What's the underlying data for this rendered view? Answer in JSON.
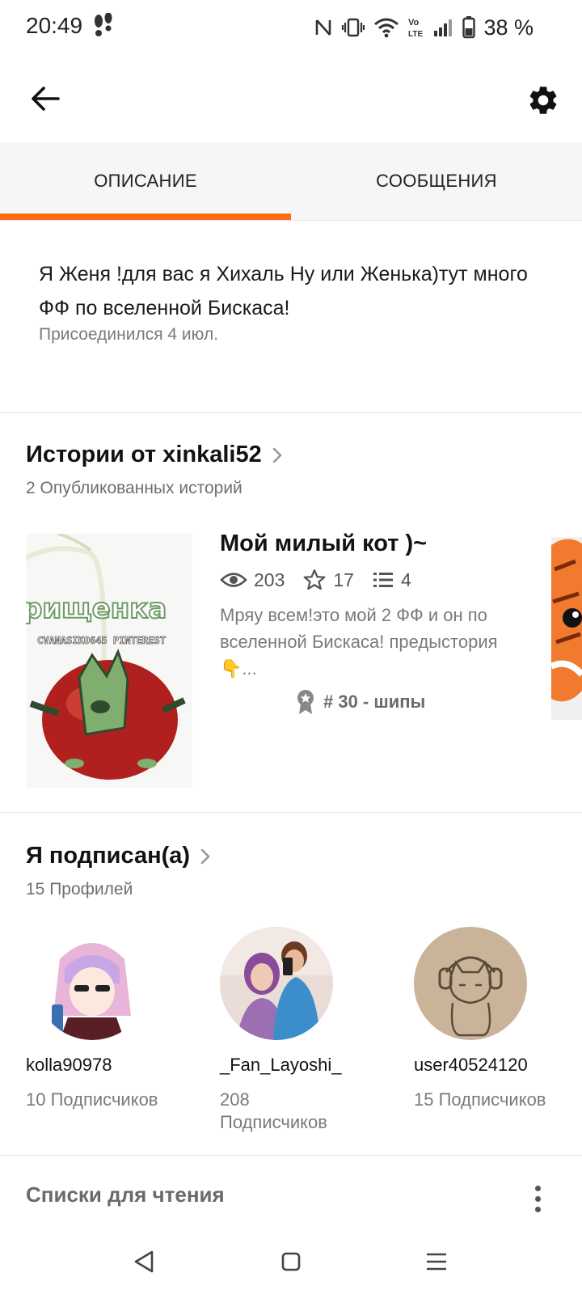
{
  "status_bar": {
    "time": "20:49",
    "battery": "38 %"
  },
  "tabs": [
    {
      "label": "ОПИСАНИЕ"
    },
    {
      "label": "СООБЩЕНИЯ"
    }
  ],
  "profile_description": {
    "text": "Я Женя !для вас я Хихаль Ну или Женька)тут много ФФ по вселенной Бискаса!",
    "joined": "Присоединился 4 июл."
  },
  "stories_section": {
    "title": "Истории от xinkali52",
    "subtitle": "2 Опубликованных историй",
    "story": {
      "title": "Мой милый кот )~",
      "views": "203",
      "votes": "17",
      "parts": "4",
      "blurb": "Мряу всем!это мой 2 ФФ и он по вселенной Бискаса! предыстория👇...",
      "rank": "# 30 - шипы",
      "cover_text": "рищенка",
      "cover_watermark": "CVANASIKO645 PINTEREST"
    }
  },
  "following_section": {
    "title": "Я подписан(а)",
    "subtitle": "15 Профилей",
    "profiles": [
      {
        "username": "kolla90978",
        "followers": "10 Подписчиков"
      },
      {
        "username": "_Fan_Layoshi_",
        "followers": "208 Подписчиков"
      },
      {
        "username": "user40524120",
        "followers": "15 Подписчиков"
      }
    ]
  },
  "reading_lists": {
    "label": "Списки для чтения"
  },
  "colors": {
    "accent": "#ff6b12",
    "tab_bg": "#f6f5f7"
  }
}
